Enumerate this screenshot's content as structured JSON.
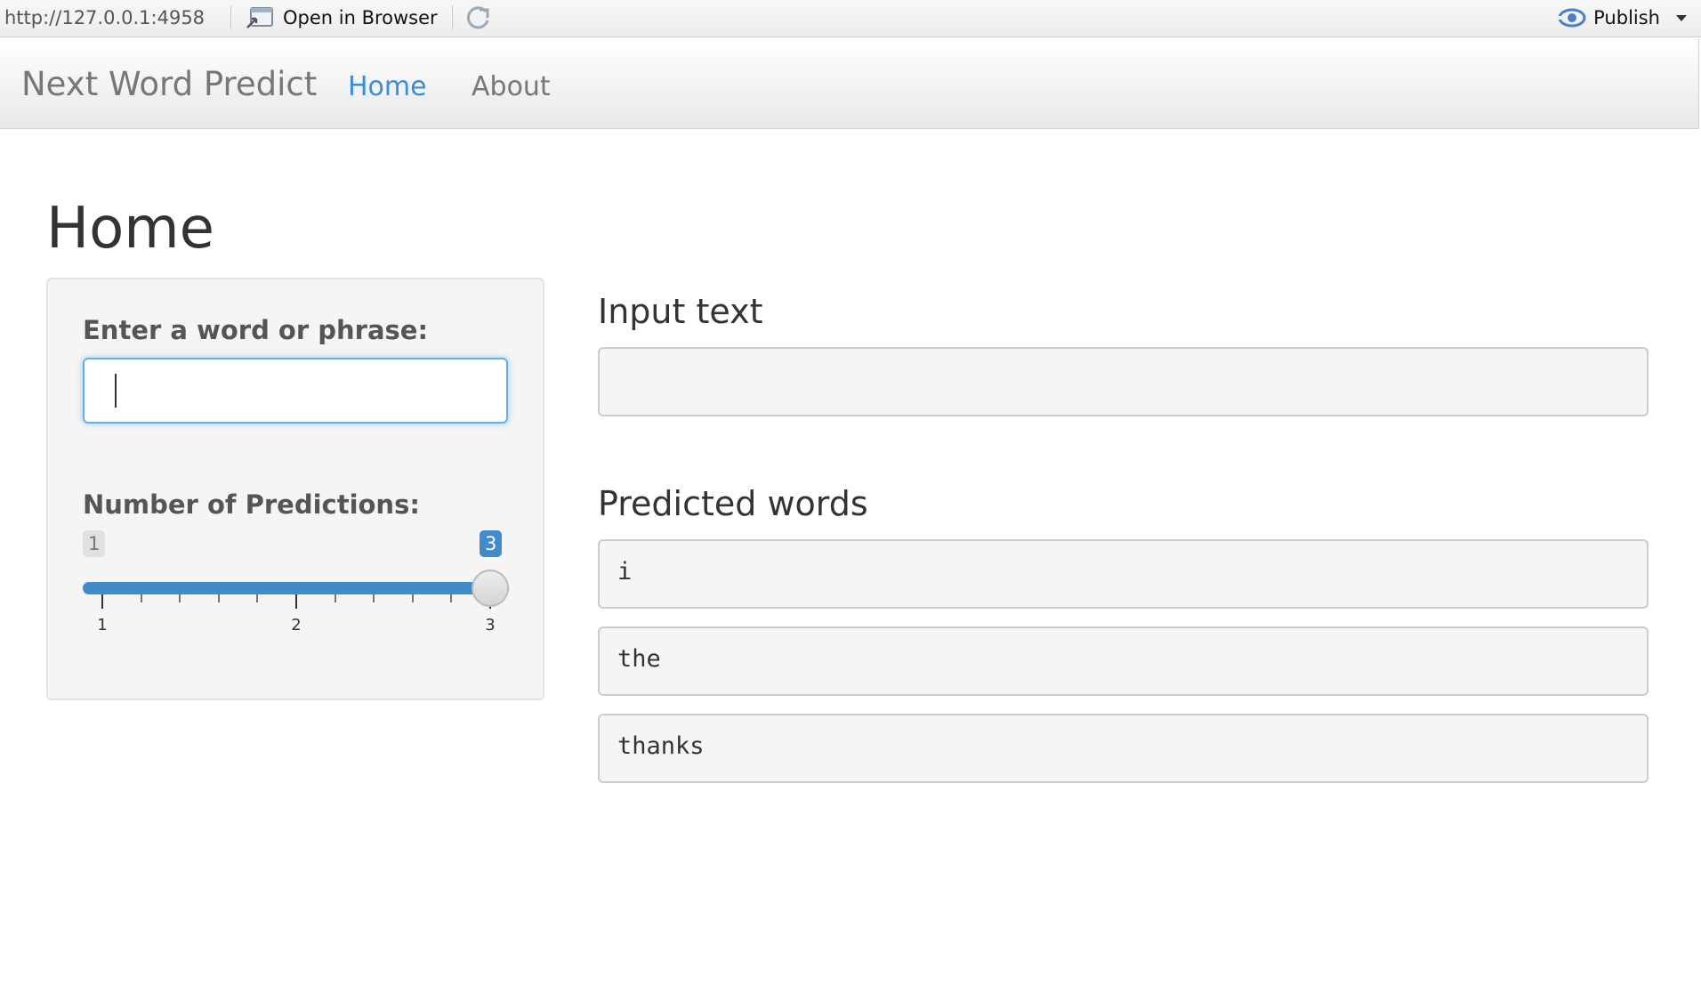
{
  "viewer_toolbar": {
    "url": "http://127.0.0.1:4958",
    "open_in_browser": "Open in Browser",
    "publish": "Publish"
  },
  "navbar": {
    "brand": "Next Word Predict",
    "tabs": [
      {
        "label": "Home",
        "active": true
      },
      {
        "label": "About",
        "active": false
      }
    ]
  },
  "page": {
    "title": "Home"
  },
  "sidebar": {
    "text_input": {
      "label": "Enter a word or phrase:",
      "value": ""
    },
    "slider": {
      "label": "Number of Predictions:",
      "min": 1,
      "max": 3,
      "value": 3,
      "min_badge": "1",
      "value_badge": "3",
      "tick_labels": [
        "1",
        "2",
        "3"
      ]
    }
  },
  "main": {
    "input_heading": "Input text",
    "input_text": "",
    "predicted_heading": "Predicted words",
    "predictions": [
      "i",
      "the",
      "thanks"
    ]
  },
  "colors": {
    "accent": "#428bca",
    "active_tab": "#3a8ed8",
    "focus_border": "#66afe9"
  }
}
